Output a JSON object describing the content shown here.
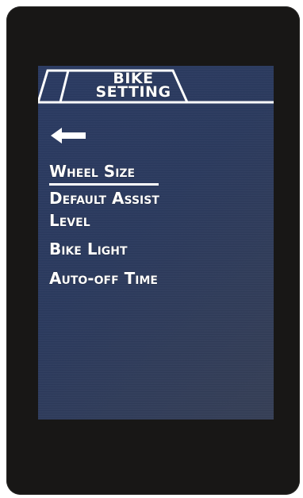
{
  "header": {
    "title_line1": "BIKE",
    "title_line2": "SETTING"
  },
  "navigation": {
    "back_icon": "left-arrow-icon"
  },
  "menu": {
    "items": [
      {
        "label": "Wheel Size",
        "selected": true
      },
      {
        "label_line1": "Default Assist",
        "label_line2": "Level",
        "selected": false
      },
      {
        "label": "Bike Light",
        "selected": false
      },
      {
        "label": "Auto-off Time",
        "selected": false
      }
    ]
  },
  "colors": {
    "screen_background": "#2b3a5e",
    "device_bezel": "#181716",
    "text": "#ffffff"
  }
}
